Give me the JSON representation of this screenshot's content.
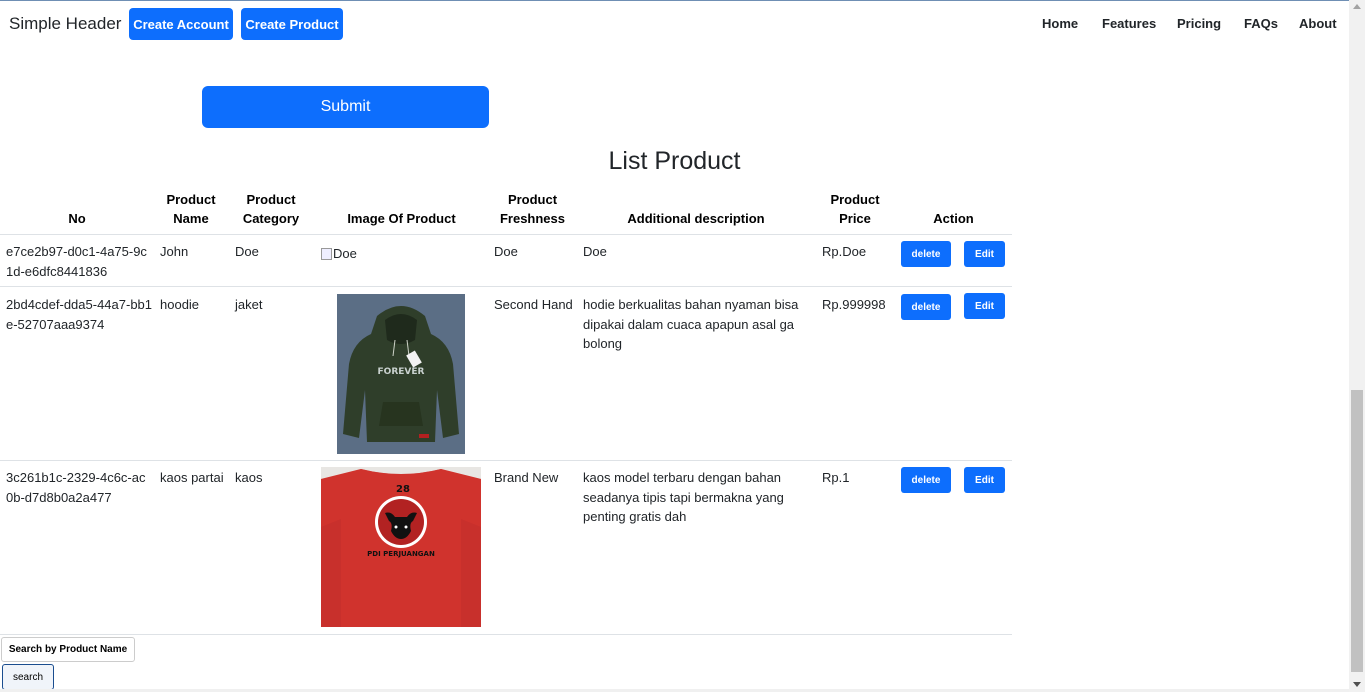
{
  "header": {
    "brand": "Simple Header",
    "buttons": [
      "Create Account",
      "Create Product"
    ],
    "nav": [
      "Home",
      "Features",
      "Pricing",
      "FAQs",
      "About"
    ]
  },
  "form": {
    "submit_label": "Submit"
  },
  "list": {
    "title": "List Product",
    "columns": [
      [
        "No"
      ],
      [
        "Product",
        "Name"
      ],
      [
        "Product",
        "Category"
      ],
      [
        "Image Of Product"
      ],
      [
        "Product",
        "Freshness"
      ],
      [
        "Additional description"
      ],
      [
        "Product",
        "Price"
      ],
      [
        "Action"
      ]
    ],
    "rows": [
      {
        "id": "e7ce2b97-d0c1-4a75-9c1d-e6dfc8441836",
        "name": "John",
        "category": "Doe",
        "image_alt": "Doe",
        "freshness": "Doe",
        "description": "Doe",
        "price": "Rp.Doe",
        "delete_label": "delete",
        "edit_label": "Edit"
      },
      {
        "id": "2bd4cdef-dda5-44a7-bb1e-52707aaa9374",
        "name": "hoodie",
        "category": "jaket",
        "image_text": "FOREVER",
        "freshness": "Second Hand",
        "description": "hodie berkualitas bahan nyaman bisa dipakai dalam cuaca apapun asal ga bolong",
        "price": "Rp.999998",
        "delete_label": "delete",
        "edit_label": "Edit"
      },
      {
        "id": "3c261b1c-2329-4c6c-ac0b-d7d8b0a2a477",
        "name": "kaos partai",
        "category": "kaos",
        "image_number": "28",
        "image_text": "PDI PERJUANGAN",
        "freshness": "Brand New",
        "description": "kaos model terbaru dengan bahan seadanya tipis tapi bermakna yang penting gratis dah",
        "price": "Rp.1",
        "delete_label": "delete",
        "edit_label": "Edit"
      }
    ]
  },
  "search": {
    "label": "Search by Product Name",
    "button": "search"
  },
  "colors": {
    "primary": "#0d6efd",
    "text": "#212529",
    "divider": "#dee2e6",
    "shirt_red": "#c8302c",
    "hoodie_green": "#2f3e2a"
  }
}
